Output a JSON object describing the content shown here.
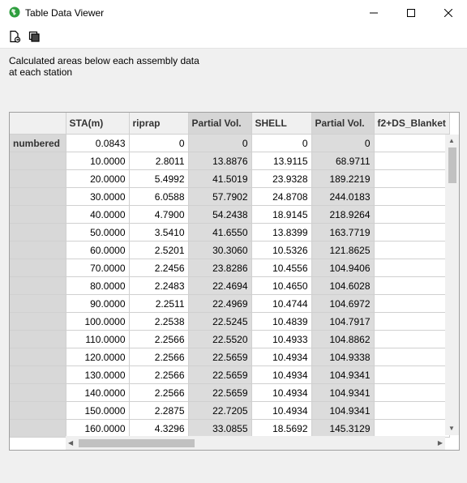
{
  "window": {
    "title": "Table Data Viewer"
  },
  "description": {
    "line1": "Calculated areas below each assembly data",
    "line2": "at each station"
  },
  "table": {
    "columns": [
      "STA(m)",
      "riprap",
      "Partial Vol.",
      "SHELL",
      "Partial Vol.",
      "f2+DS_Blanket"
    ],
    "rows": [
      {
        "label": "numbered",
        "cells": [
          "0.0843",
          "0",
          "0",
          "0",
          "0",
          ""
        ]
      },
      {
        "label": "",
        "cells": [
          "10.0000",
          "2.8011",
          "13.8876",
          "13.9115",
          "68.9711",
          ""
        ]
      },
      {
        "label": "",
        "cells": [
          "20.0000",
          "5.4992",
          "41.5019",
          "23.9328",
          "189.2219",
          ""
        ]
      },
      {
        "label": "",
        "cells": [
          "30.0000",
          "6.0588",
          "57.7902",
          "24.8708",
          "244.0183",
          ""
        ]
      },
      {
        "label": "",
        "cells": [
          "40.0000",
          "4.7900",
          "54.2438",
          "18.9145",
          "218.9264",
          ""
        ]
      },
      {
        "label": "",
        "cells": [
          "50.0000",
          "3.5410",
          "41.6550",
          "13.8399",
          "163.7719",
          ""
        ]
      },
      {
        "label": "",
        "cells": [
          "60.0000",
          "2.5201",
          "30.3060",
          "10.5326",
          "121.8625",
          ""
        ]
      },
      {
        "label": "",
        "cells": [
          "70.0000",
          "2.2456",
          "23.8286",
          "10.4556",
          "104.9406",
          ""
        ]
      },
      {
        "label": "",
        "cells": [
          "80.0000",
          "2.2483",
          "22.4694",
          "10.4650",
          "104.6028",
          ""
        ]
      },
      {
        "label": "",
        "cells": [
          "90.0000",
          "2.2511",
          "22.4969",
          "10.4744",
          "104.6972",
          ""
        ]
      },
      {
        "label": "",
        "cells": [
          "100.0000",
          "2.2538",
          "22.5245",
          "10.4839",
          "104.7917",
          ""
        ]
      },
      {
        "label": "",
        "cells": [
          "110.0000",
          "2.2566",
          "22.5520",
          "10.4933",
          "104.8862",
          ""
        ]
      },
      {
        "label": "",
        "cells": [
          "120.0000",
          "2.2566",
          "22.5659",
          "10.4934",
          "104.9338",
          ""
        ]
      },
      {
        "label": "",
        "cells": [
          "130.0000",
          "2.2566",
          "22.5659",
          "10.4934",
          "104.9341",
          ""
        ]
      },
      {
        "label": "",
        "cells": [
          "140.0000",
          "2.2566",
          "22.5659",
          "10.4934",
          "104.9341",
          ""
        ]
      },
      {
        "label": "",
        "cells": [
          "150.0000",
          "2.2875",
          "22.7205",
          "10.4934",
          "104.9341",
          ""
        ]
      },
      {
        "label": "",
        "cells": [
          "160.0000",
          "4.3296",
          "33.0855",
          "18.5692",
          "145.3129",
          ""
        ]
      }
    ]
  },
  "icons": {
    "app": "app-globe-icon",
    "minimize": "minimize-icon",
    "maximize": "maximize-icon",
    "close": "close-icon",
    "export": "export-document-icon",
    "copy": "copy-icon"
  },
  "colors": {
    "app_icon": "#2e9e3e",
    "shaded_column": "#dcdcdc"
  }
}
